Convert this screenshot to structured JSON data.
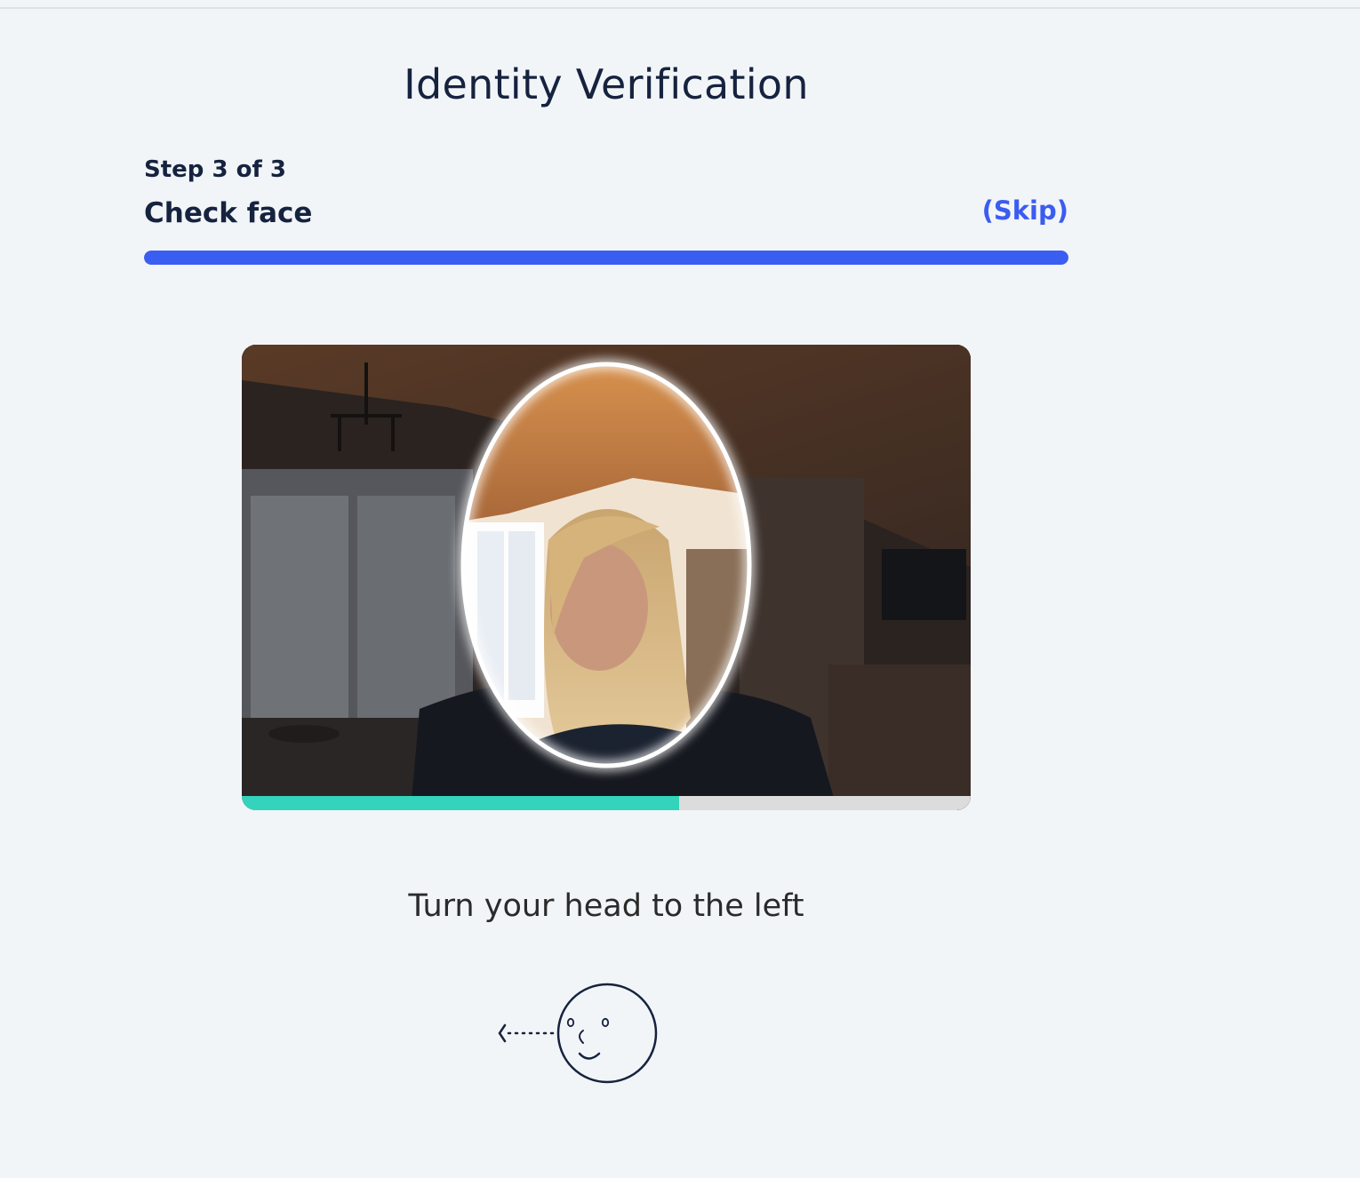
{
  "header": {
    "title": "Identity Verification"
  },
  "step": {
    "label": "Step 3 of 3",
    "name": "Check face",
    "skip_label": "(Skip)",
    "progress": 1.0,
    "progress_color": "#3b5ef2"
  },
  "camera": {
    "scan_progress": 0.6,
    "scan_color": "#33d4bb",
    "oval_color": "#ffffff"
  },
  "instruction": {
    "text": "Turn your head to the left",
    "icon": "face-turn-left-icon"
  }
}
